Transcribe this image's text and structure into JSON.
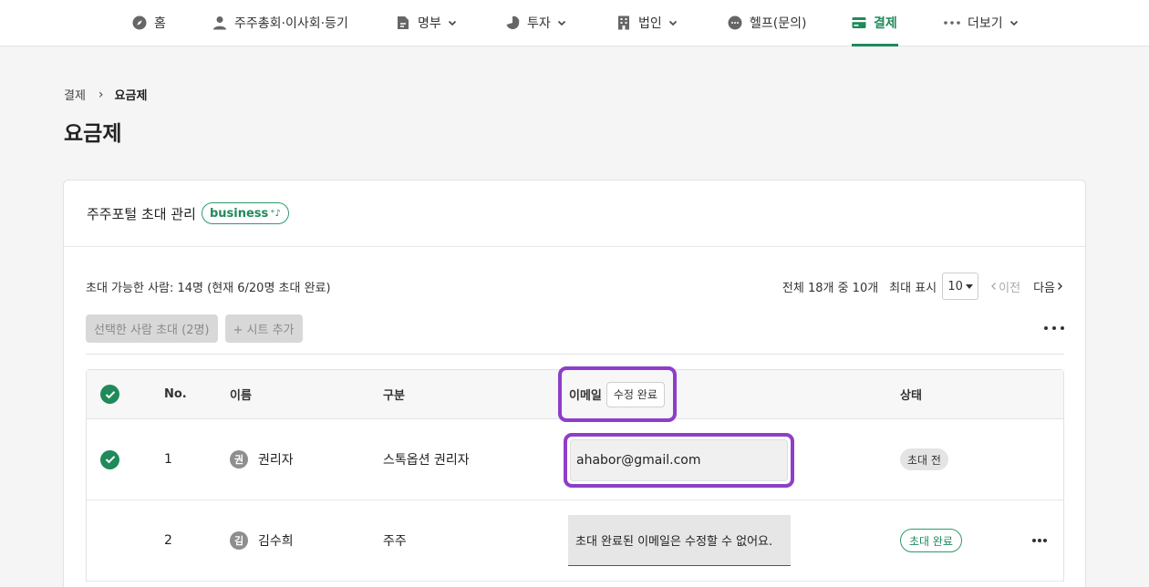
{
  "nav": {
    "home": "홈",
    "meetings": "주주총회·이사회·등기",
    "registry": "명부",
    "investment": "투자",
    "corporation": "법인",
    "help": "헬프(문의)",
    "billing": "결제",
    "more": "더보기"
  },
  "breadcrumb": {
    "parent": "결제",
    "current": "요금제"
  },
  "page_title": "요금제",
  "card": {
    "title": "주주포털 초대 관리",
    "badge": "business",
    "invite_info": "초대 가능한 사람: 14명 (현재 6/20명 초대 완료)",
    "pager": {
      "total": "전체 18개 중 10개",
      "max_label": "최대 표시",
      "page_size": "10",
      "prev": "이전",
      "next": "다음"
    },
    "actions": {
      "invite_selected": "선택한 사람 초대 (2명)",
      "add_sheet": "+ 시트 추가"
    }
  },
  "table": {
    "headers": {
      "no": "No.",
      "name": "이름",
      "type": "구분",
      "email": "이메일",
      "edit_done": "수정 완료",
      "status": "상태"
    },
    "rows": [
      {
        "no": "1",
        "avatar": "권",
        "name": "권리자",
        "type": "스톡옵션 권리자",
        "email": "ahabor@gmail.com",
        "status": "초대 전"
      },
      {
        "no": "2",
        "avatar": "김",
        "name": "김수희",
        "type": "주주",
        "email": "초대 완료된 이메일은 수정할 수 없어요.",
        "status": "초대 완료"
      }
    ]
  },
  "colors": {
    "accent": "#1f8a5b",
    "highlight": "#8e3ec7"
  }
}
